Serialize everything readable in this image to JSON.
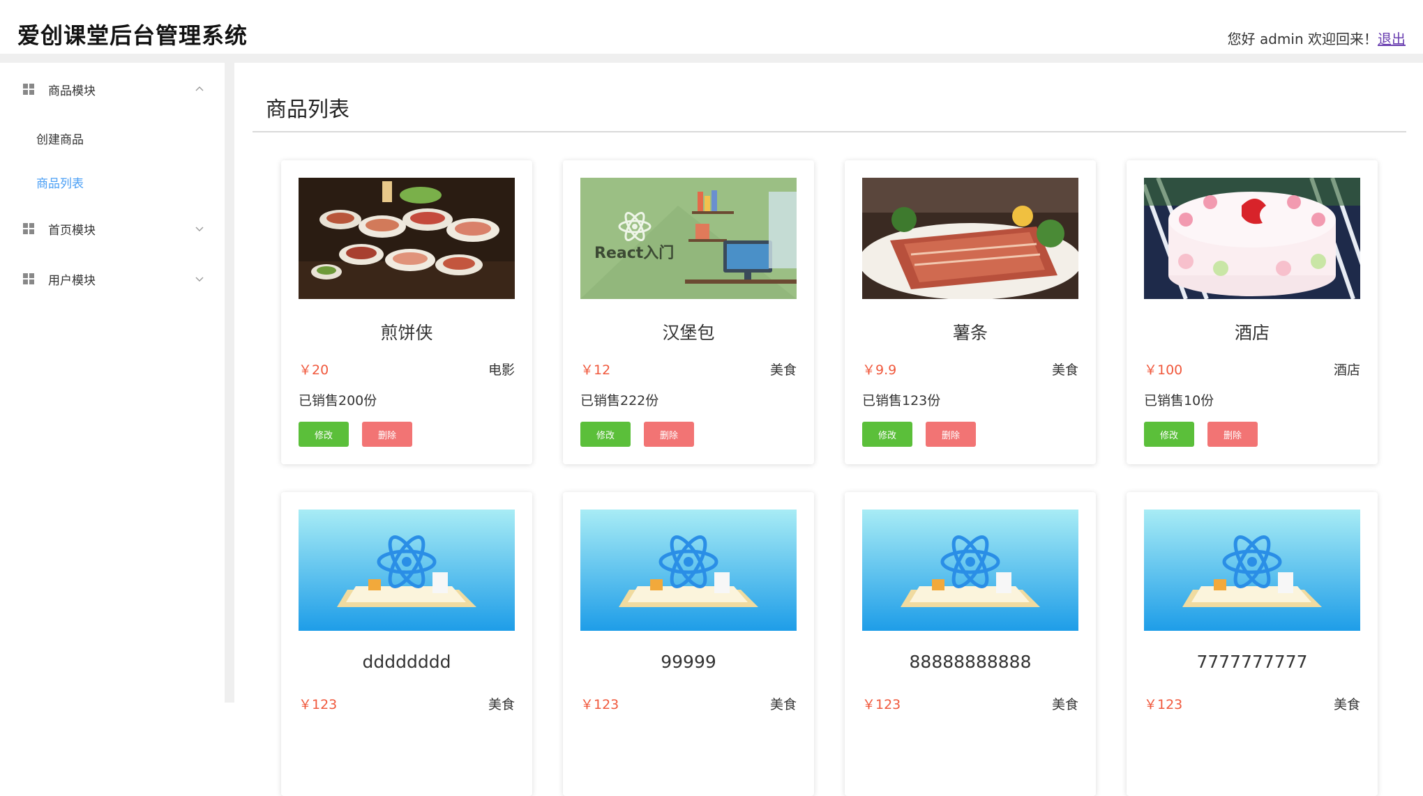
{
  "header": {
    "app_title": "爱创课堂后台管理系统",
    "greeting": "您好 admin 欢迎回来！",
    "logout": "退出"
  },
  "sidebar": {
    "groups": [
      {
        "label": "商品模块",
        "expanded": true,
        "icon": "grid-icon",
        "chevron": "chevron-up-icon"
      },
      {
        "label": "首页模块",
        "expanded": false,
        "icon": "grid-icon",
        "chevron": "chevron-down-icon"
      },
      {
        "label": "用户模块",
        "expanded": false,
        "icon": "grid-icon",
        "chevron": "chevron-down-icon"
      }
    ],
    "sub_items": [
      {
        "label": "创建商品",
        "active": false
      },
      {
        "label": "商品列表",
        "active": true
      }
    ]
  },
  "main": {
    "page_title": "商品列表",
    "products": [
      {
        "name": "煎饼侠",
        "price": "￥20",
        "category": "电影",
        "sold": "已销售200份",
        "edit": "修改",
        "delete": "删除",
        "image": "food-platter-photo"
      },
      {
        "name": "汉堡包",
        "price": "￥12",
        "category": "美食",
        "sold": "已销售222份",
        "edit": "修改",
        "delete": "删除",
        "image": "react-intro-illustration",
        "image_text": "React入门"
      },
      {
        "name": "薯条",
        "price": "￥9.9",
        "category": "美食",
        "sold": "已销售123份",
        "edit": "修改",
        "delete": "删除",
        "image": "grilled-meat-photo"
      },
      {
        "name": "酒店",
        "price": "￥100",
        "category": "酒店",
        "sold": "已销售10份",
        "edit": "修改",
        "delete": "删除",
        "image": "cake-photo"
      },
      {
        "name": "dddddddd",
        "price": "￥123",
        "category": "美食",
        "image": "react-logo-illustration"
      },
      {
        "name": "99999",
        "price": "￥123",
        "category": "美食",
        "image": "react-logo-illustration"
      },
      {
        "name": "88888888888",
        "price": "￥123",
        "category": "美食",
        "image": "react-logo-illustration"
      },
      {
        "name": "7777777777",
        "price": "￥123",
        "category": "美食",
        "image": "react-logo-illustration"
      }
    ]
  },
  "colors": {
    "accent_blue": "#4a9ff5",
    "price_red": "#f0583c",
    "edit_green": "#5bbf3a",
    "delete_red": "#f27474"
  }
}
